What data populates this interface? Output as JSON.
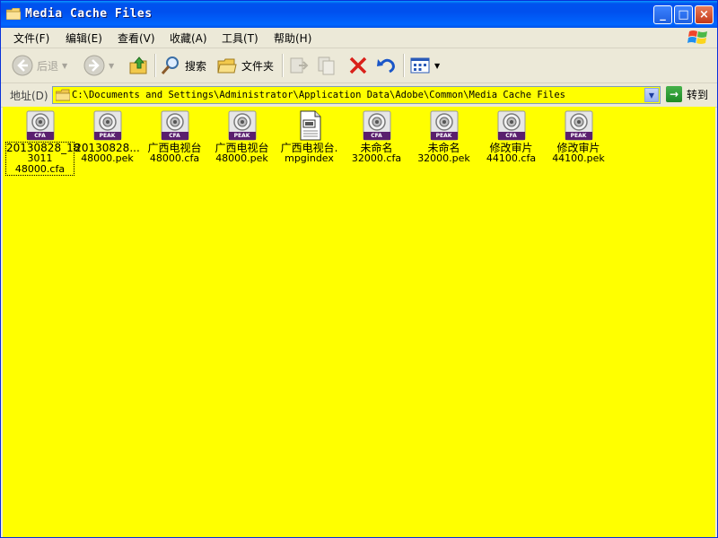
{
  "window": {
    "title": "Media Cache Files",
    "controls": {
      "minimize": "_",
      "maximize": "□",
      "close": "×"
    }
  },
  "menubar": {
    "items": [
      "文件(F)",
      "编辑(E)",
      "查看(V)",
      "收藏(A)",
      "工具(T)",
      "帮助(H)"
    ]
  },
  "toolbar": {
    "back_label": "后退",
    "search_label": "搜索",
    "folders_label": "文件夹"
  },
  "addressbar": {
    "label": "地址(D)",
    "path": "C:\\Documents and Settings\\Administrator\\Application Data\\Adobe\\Common\\Media Cache Files",
    "go_label": "转到"
  },
  "files": [
    {
      "line1": "20130828_18",
      "line2": "3011",
      "line3": "48000.cfa",
      "type": "CFA",
      "selected": true
    },
    {
      "line1": "20130828...",
      "line2": "48000.pek",
      "line3": "",
      "type": "PEAK",
      "selected": false
    },
    {
      "line1": "广西电视台",
      "line2": "48000.cfa",
      "line3": "",
      "type": "CFA",
      "selected": false
    },
    {
      "line1": "广西电视台",
      "line2": "48000.pek",
      "line3": "",
      "type": "PEAK",
      "selected": false
    },
    {
      "line1": "广西电视台.",
      "line2": "mpgindex",
      "line3": "",
      "type": "doc",
      "selected": false
    },
    {
      "line1": "未命名",
      "line2": "32000.cfa",
      "line3": "",
      "type": "CFA",
      "selected": false
    },
    {
      "line1": "未命名",
      "line2": "32000.pek",
      "line3": "",
      "type": "PEAK",
      "selected": false
    },
    {
      "line1": "修改审片",
      "line2": "44100.cfa",
      "line3": "",
      "type": "CFA",
      "selected": false
    },
    {
      "line1": "修改审片",
      "line2": "44100.pek",
      "line3": "",
      "type": "PEAK",
      "selected": false
    }
  ],
  "colors": {
    "content_background": "#ffff00",
    "titlebar": "#0053ee"
  }
}
